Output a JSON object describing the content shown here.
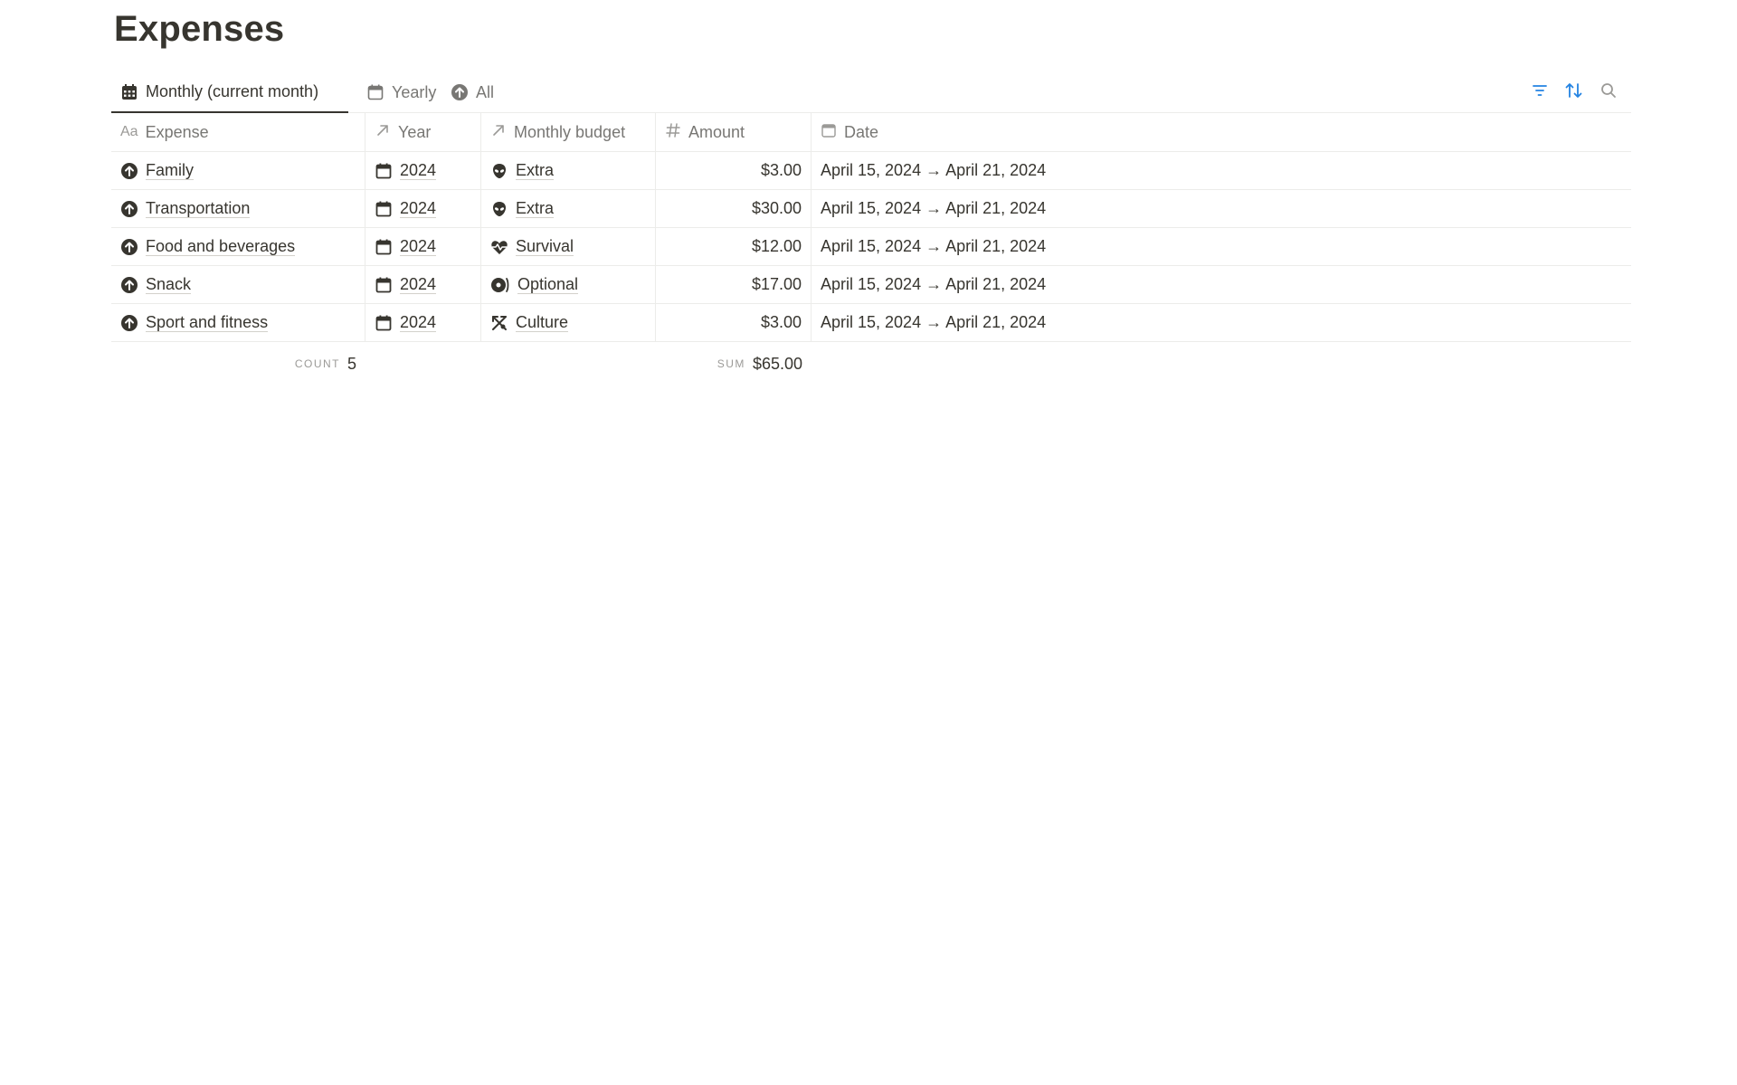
{
  "page": {
    "title": "Expenses"
  },
  "tabs": [
    {
      "label": "Monthly (current month)",
      "icon": "calendar-grid-icon",
      "active": true
    },
    {
      "label": "Yearly",
      "icon": "calendar-icon",
      "active": false
    },
    {
      "label": "All",
      "icon": "arrow-up-circle-icon",
      "active": false
    }
  ],
  "toolbar": {
    "filter_icon": "filter-icon",
    "sort_icon": "sort-icon",
    "search_icon": "search-icon",
    "accent": "#2383e2"
  },
  "table": {
    "columns": [
      {
        "label": "Expense",
        "icon": "text-type-icon"
      },
      {
        "label": "Year",
        "icon": "relation-arrow-icon"
      },
      {
        "label": "Monthly budget",
        "icon": "relation-arrow-icon"
      },
      {
        "label": "Amount",
        "icon": "hash-icon"
      },
      {
        "label": "Date",
        "icon": "calendar-icon"
      }
    ],
    "rows": [
      {
        "expense": "Family",
        "year": "2024",
        "budget": "Extra",
        "budget_icon": "alien-icon",
        "amount": "$3.00",
        "date": "April 15, 2024 → April 21, 2024"
      },
      {
        "expense": "Transportation",
        "year": "2024",
        "budget": "Extra",
        "budget_icon": "alien-icon",
        "amount": "$30.00",
        "date": "April 15, 2024 → April 21, 2024"
      },
      {
        "expense": "Food and beverages",
        "year": "2024",
        "budget": "Survival",
        "budget_icon": "heartbeat-icon",
        "amount": "$12.00",
        "date": "April 15, 2024 → April 21, 2024"
      },
      {
        "expense": "Snack",
        "year": "2024",
        "budget": "Optional",
        "budget_icon": "music-icon",
        "amount": "$17.00",
        "date": "April 15, 2024 → April 21, 2024"
      },
      {
        "expense": "Sport and fitness",
        "year": "2024",
        "budget": "Culture",
        "budget_icon": "palette-icon",
        "amount": "$3.00",
        "date": "April 15, 2024 → April 21, 2024"
      }
    ]
  },
  "footer": {
    "count_label": "COUNT",
    "count_value": "5",
    "sum_label": "SUM",
    "sum_value": "$65.00"
  }
}
